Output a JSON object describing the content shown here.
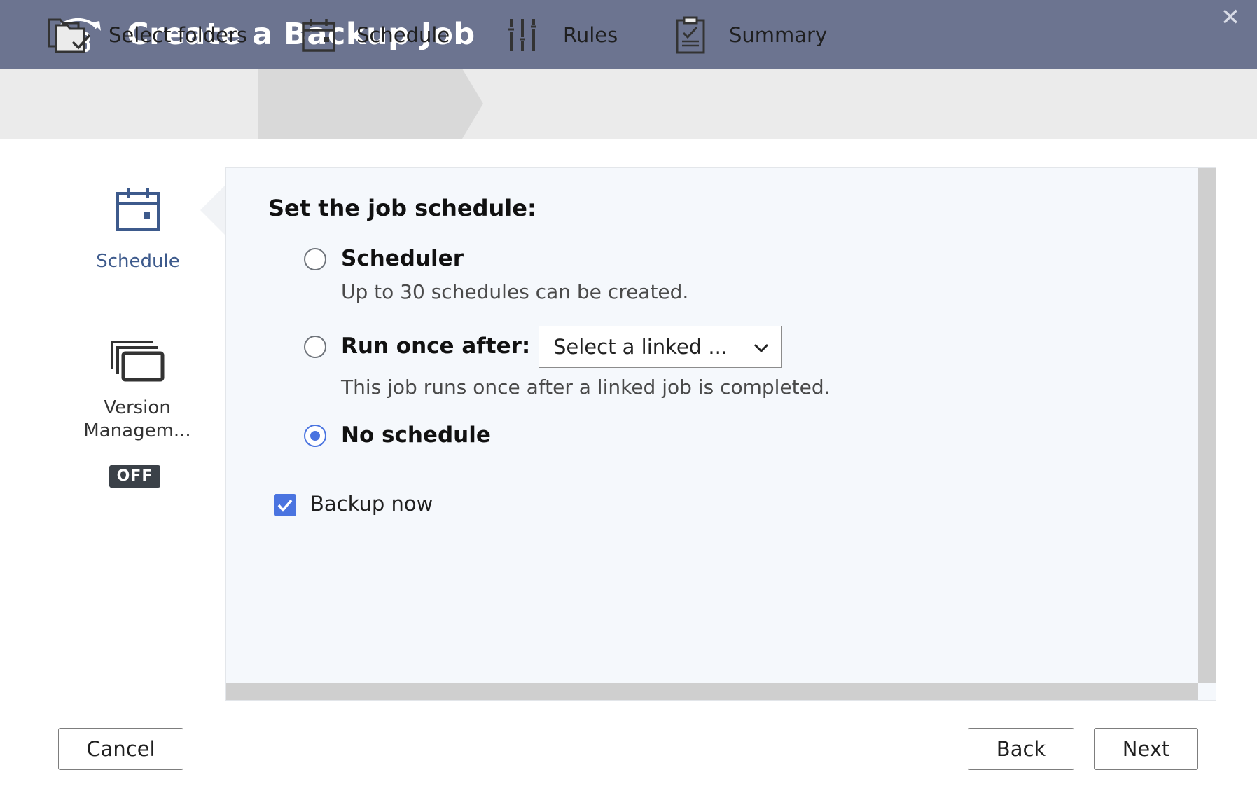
{
  "window": {
    "title": "Create a Backup Job",
    "close_icon": "close-icon"
  },
  "steps": [
    {
      "label": "Select folders",
      "icon": "folder-check-icon",
      "active": false
    },
    {
      "label": "Schedule",
      "icon": "calendar-icon",
      "active": true
    },
    {
      "label": "Rules",
      "icon": "sliders-icon",
      "active": false
    },
    {
      "label": "Summary",
      "icon": "clipboard-check-icon",
      "active": false
    }
  ],
  "sidebar": {
    "items": [
      {
        "label": "Schedule",
        "icon": "calendar-icon",
        "active": true
      },
      {
        "label_line1": "Version",
        "label_line2": "Managem...",
        "icon": "versions-icon",
        "badge": "OFF"
      }
    ]
  },
  "main": {
    "heading": "Set the job schedule:",
    "options": {
      "scheduler": {
        "label": "Scheduler",
        "desc": "Up to 30 schedules can be created.",
        "checked": false
      },
      "run_once": {
        "label": "Run once after:",
        "desc": "This job runs once after a linked job is completed.",
        "checked": false,
        "select_value": "Select a linked  ..."
      },
      "no_schedule": {
        "label": "No schedule",
        "checked": true
      }
    },
    "backup_now": {
      "label": "Backup now",
      "checked": true
    }
  },
  "footer": {
    "cancel": "Cancel",
    "back": "Back",
    "next": "Next"
  },
  "colors": {
    "titlebar": "#6c7490",
    "accent": "#4a74e0",
    "sidebar_active": "#3d5a8c"
  }
}
